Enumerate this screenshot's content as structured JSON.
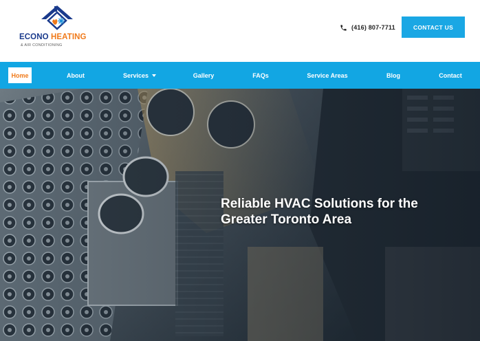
{
  "brand": {
    "name_part1": "ECONO",
    "name_part2": "HEATING",
    "tagline": "& AIR CONDITIONING",
    "colors": {
      "primary_blue": "#1a3a8c",
      "accent_orange": "#f07a1a"
    },
    "logo_icon": "house-flame-snowflake-icon"
  },
  "header": {
    "phone": "(416) 807-7711",
    "phone_icon": "phone-icon",
    "contact_label": "CONTACT US"
  },
  "nav": {
    "color": "#12a6e3",
    "active_color": "#f07a1a",
    "items": [
      {
        "label": "Home",
        "active": true
      },
      {
        "label": "About"
      },
      {
        "label": "Services",
        "has_dropdown": true
      },
      {
        "label": "Gallery"
      },
      {
        "label": "FAQs"
      },
      {
        "label": "Service Areas"
      },
      {
        "label": "Blog"
      },
      {
        "label": "Contact"
      }
    ]
  },
  "hero": {
    "title": "Reliable HVAC Solutions for the Greater Toronto Area",
    "background": "rooftop-hvac-units-photo"
  }
}
